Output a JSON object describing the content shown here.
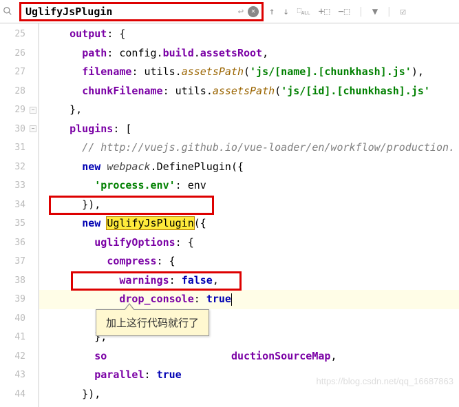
{
  "search": {
    "value": "UglifyJsPlugin"
  },
  "gutter": {
    "start": 25,
    "end": 44
  },
  "code": {
    "l25": {
      "indent": "    ",
      "prop": "output",
      "rest": ": {"
    },
    "l26": {
      "indent": "      ",
      "prop": "path",
      "obj": "config",
      "sub": "build",
      "sub2": "assetsRoot"
    },
    "l27": {
      "indent": "      ",
      "prop": "filename",
      "obj": "utils",
      "fn": "assetsPath",
      "str": "'js/[name].[chunkhash].js'"
    },
    "l28": {
      "indent": "      ",
      "prop": "chunkFilename",
      "obj": "utils",
      "fn": "assetsPath",
      "str": "'js/[id].[chunkhash].js'"
    },
    "l29": {
      "text": "    },"
    },
    "l30": {
      "indent": "    ",
      "prop": "plugins",
      "rest": ": ["
    },
    "l31": {
      "cmt": "      // http://vuejs.github.io/vue-loader/en/workflow/production."
    },
    "l32": {
      "indent": "      ",
      "kw": "new",
      "obj": "webpack",
      "cls": "DefinePlugin",
      "rest": "({"
    },
    "l33": {
      "indent": "        ",
      "str": "'process.env'",
      "rest": ": env"
    },
    "l34": {
      "text": "      }),"
    },
    "l35": {
      "indent": "      ",
      "kw": "new",
      "cls": "UglifyJsPlugin",
      "rest": "({"
    },
    "l36": {
      "indent": "        ",
      "prop": "uglifyOptions",
      "rest": ": {"
    },
    "l37": {
      "indent": "          ",
      "prop": "compress",
      "rest": ": {"
    },
    "l38": {
      "indent": "            ",
      "prop": "warnings",
      "val": "false"
    },
    "l39": {
      "indent": "            ",
      "prop": "drop_console",
      "val": "true"
    },
    "l40": {
      "text": "          }"
    },
    "l41": {
      "text": "        },"
    },
    "l42": {
      "indent": "        ",
      "prop_pre": "so",
      "prop_post": "ductionSourceMap"
    },
    "l43": {
      "indent": "        ",
      "prop": "parallel",
      "val": "true"
    },
    "l44": {
      "text": "      }),"
    }
  },
  "callout": {
    "text": "加上这行代码就行了"
  },
  "watermark": "https://blog.csdn.net/qq_16687863"
}
